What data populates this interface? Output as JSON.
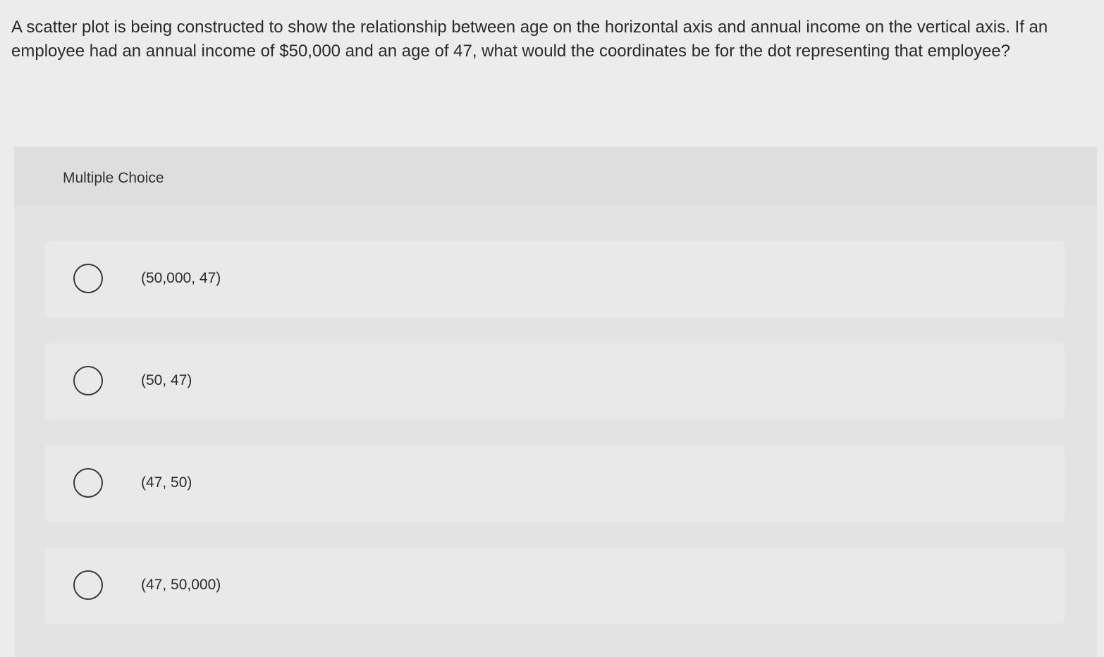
{
  "question": {
    "text": "A scatter plot is being constructed to show the relationship between age on the horizontal axis and annual income on the vertical axis. If an employee had an annual income of $50,000 and an age of 47, what would the coordinates be for the dot representing that employee?"
  },
  "multiple_choice": {
    "label": "Multiple Choice",
    "choices": [
      {
        "text": "(50,000, 47)"
      },
      {
        "text": "(50, 47)"
      },
      {
        "text": "(47, 50)"
      },
      {
        "text": "(47, 50,000)"
      }
    ]
  },
  "colors": {
    "background": "#ececec",
    "panel": "#e3e3e3",
    "choice_row": "#e9e9e9",
    "text": "#2b2b2b"
  }
}
